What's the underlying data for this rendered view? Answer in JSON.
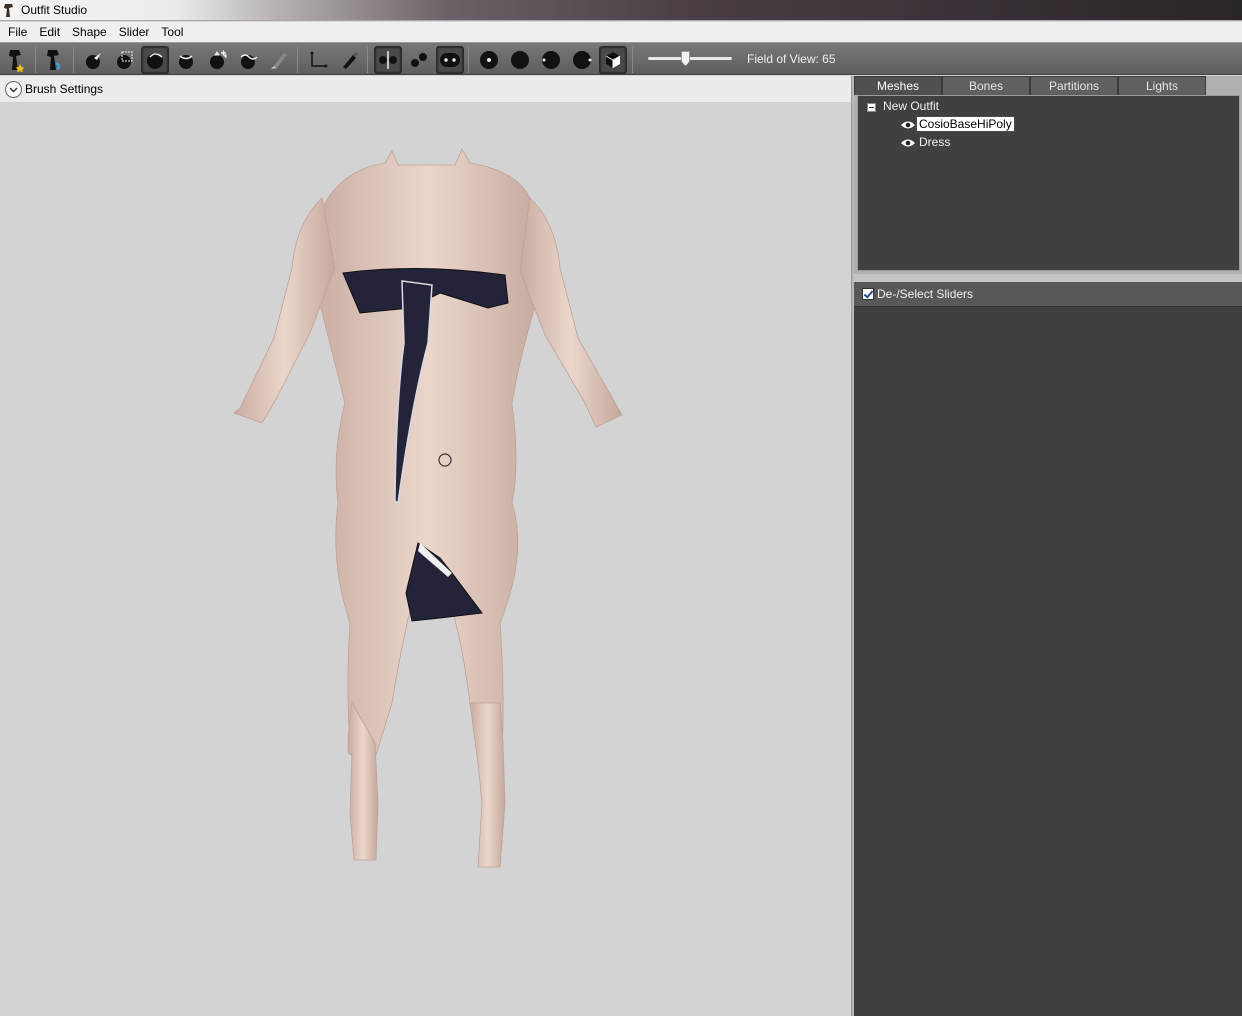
{
  "window": {
    "title": "Outfit Studio"
  },
  "menu": {
    "items": [
      "File",
      "Edit",
      "Shape",
      "Slider",
      "Tool"
    ]
  },
  "toolbar": {
    "tools": [
      {
        "name": "outfit-wizard-icon"
      },
      {
        "name": "reference-icon"
      },
      {
        "name": "select-brush-icon"
      },
      {
        "name": "mask-brush-icon"
      },
      {
        "name": "inflate-brush-icon"
      },
      {
        "name": "deflate-brush-icon"
      },
      {
        "name": "move-brush-icon"
      },
      {
        "name": "smooth-brush-icon"
      },
      {
        "name": "weight-brush-icon"
      },
      {
        "name": "transform-icon"
      },
      {
        "name": "pivot-icon"
      },
      {
        "name": "x-mirror-icon"
      },
      {
        "name": "connected-only-icon"
      },
      {
        "name": "global-brush-icon"
      },
      {
        "name": "brush-size-small-icon"
      },
      {
        "name": "brush-size-medium-icon"
      },
      {
        "name": "brush-size-large-icon"
      },
      {
        "name": "brush-size-xlarge-icon"
      },
      {
        "name": "wireframe-toggle-icon"
      }
    ],
    "field_of_view_label": "Field of View: 65",
    "field_of_view_value": 65
  },
  "brush_settings": {
    "label": "Brush Settings"
  },
  "right_panel": {
    "tabs": [
      {
        "label": "Meshes",
        "active": true
      },
      {
        "label": "Bones",
        "active": false
      },
      {
        "label": "Partitions",
        "active": false
      },
      {
        "label": "Lights",
        "active": false
      }
    ],
    "tree": {
      "root": "New Outfit",
      "children": [
        {
          "label": "CosioBaseHiPoly",
          "selected": true,
          "visible": true
        },
        {
          "label": "Dress",
          "selected": false,
          "visible": true
        }
      ]
    },
    "sliders_header": {
      "label": "De-/Select Sliders",
      "checked": true
    }
  },
  "colors": {
    "viewport_bg": "#d3d3d3",
    "panel_dark": "#404040",
    "skin": "#e4c8bd",
    "dress": "#23243a"
  }
}
